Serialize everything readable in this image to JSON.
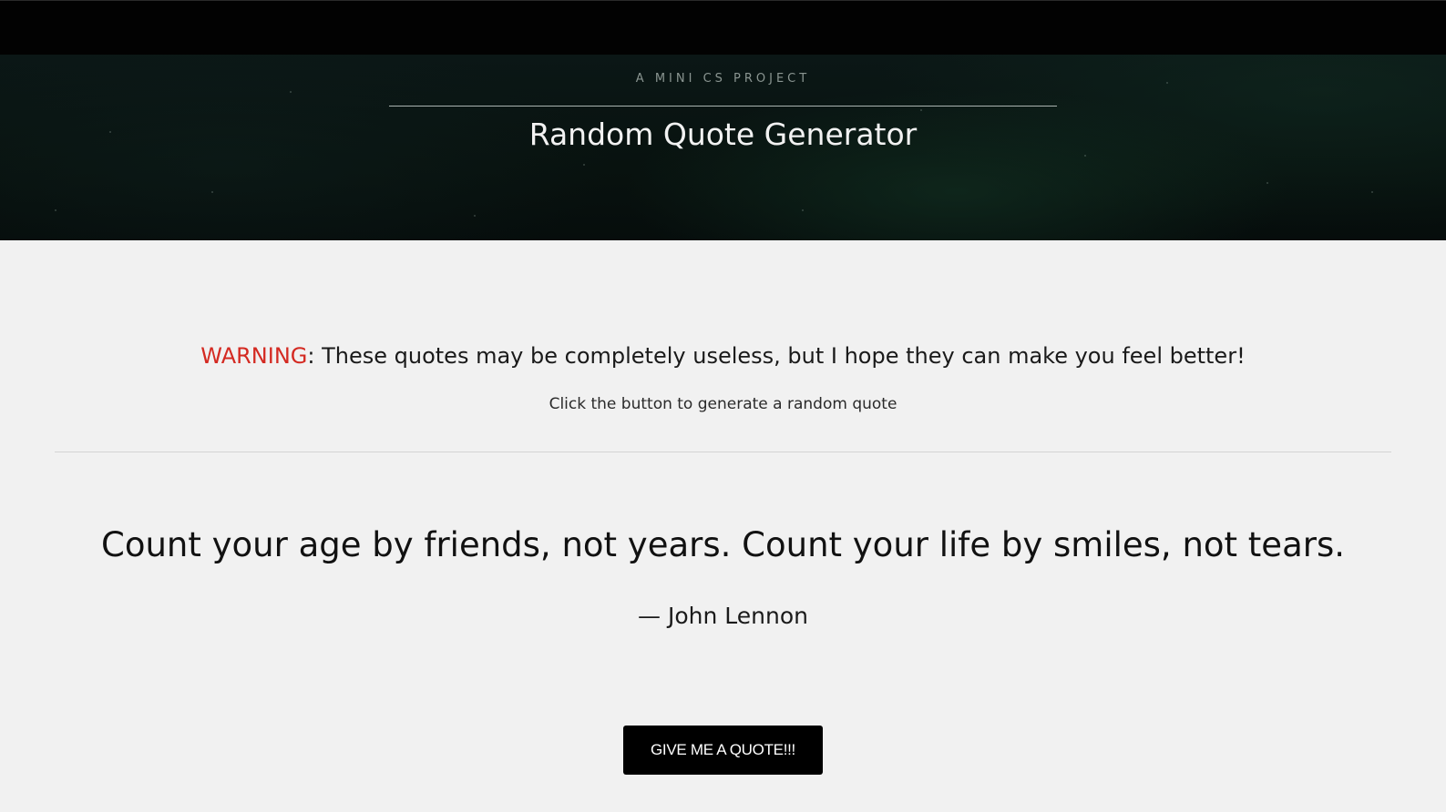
{
  "header": {
    "kicker": "A MINI CS PROJECT",
    "title": "Random Quote Generator"
  },
  "intro": {
    "warning_label": "WARNING",
    "warning_text": ": These quotes may be completely useless, but I hope they can make you feel better!",
    "hint": "Click the button to generate a random quote"
  },
  "quote": {
    "text": "Count your age by friends, not years. Count your life by smiles, not tears.",
    "author": "— John Lennon"
  },
  "button": {
    "label": "GIVE ME A QUOTE!!!"
  },
  "colors": {
    "warning": "#d42a22",
    "topbar": "#020202",
    "button_bg": "#000000",
    "page_bg": "#f1f1f1"
  }
}
